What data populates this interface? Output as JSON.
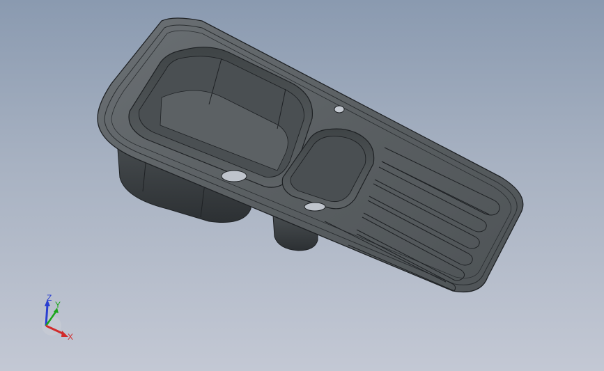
{
  "viewport": {
    "background_top": "#8a9ab0",
    "background_bottom": "#c3c8d4"
  },
  "model": {
    "object": "double-bowl-sink-with-drainboard",
    "surface_color": "#5b6063",
    "edge_color": "#1e2124"
  },
  "triad": {
    "x_label": "X",
    "y_label": "Y",
    "z_label": "Z",
    "x_color": "#d12a2a",
    "y_color": "#1aa61a",
    "z_color": "#2a3fd1"
  }
}
